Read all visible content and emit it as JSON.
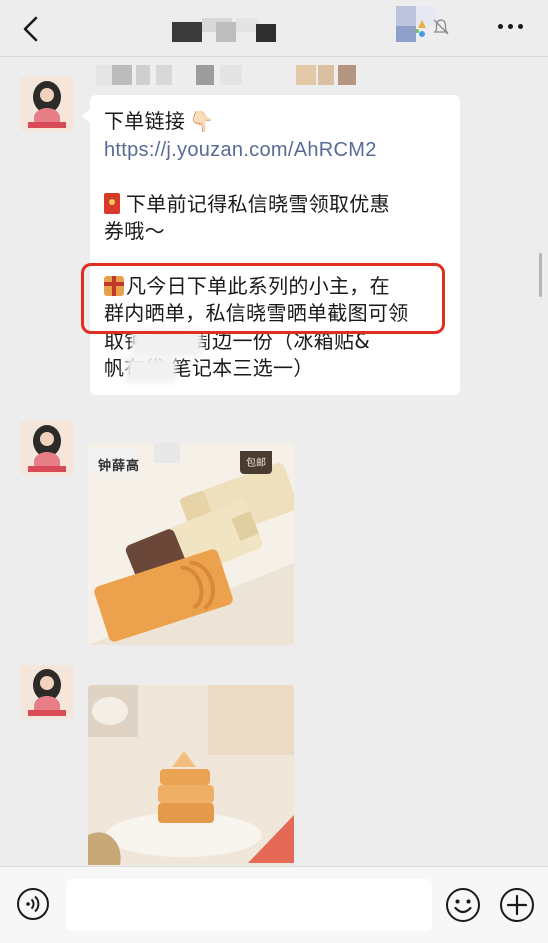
{
  "header": {
    "back_icon": "chevron-left-icon",
    "mute_icon": "bell-slash-icon",
    "more_icon": "more-dots-icon"
  },
  "messages": {
    "text_message": {
      "line1": "下单链接",
      "pointer_emoji": "👇🏻",
      "link": "https://j.youzan.com/AhRCM2",
      "line3": "下单前记得私信晓雪领取优惠",
      "line4": "券哦～",
      "line5": "凡今日下单此系列的小主，在",
      "line6": "群内晒单，私信晓雪晒单截图可领",
      "line7": "取钟      定制周边一份（冰箱贴&",
      "line8": "帆布袋      笔记本三选一）"
    },
    "image1": {
      "brand_text": "钟薛高",
      "tag_text": "包邮"
    }
  },
  "colors": {
    "link": "#576b95",
    "highlight": "#e02f20",
    "bubble": "#ffffff",
    "background": "#ededed"
  },
  "input_bar": {
    "voice_icon": "voice-icon",
    "text_value": "",
    "emoji_icon": "smiley-icon",
    "plus_icon": "plus-circle-icon"
  }
}
